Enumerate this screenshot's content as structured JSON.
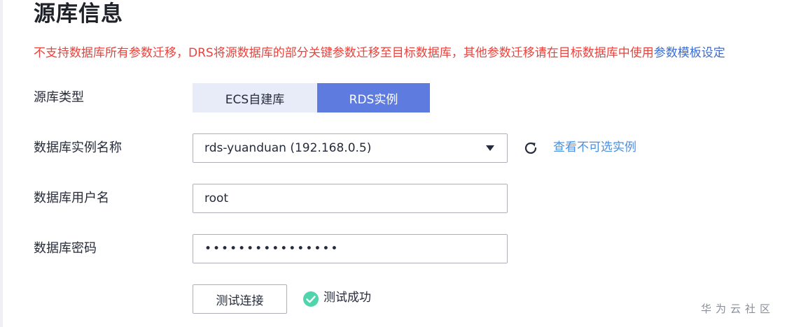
{
  "section": {
    "title": "源库信息",
    "warning_text": "不支持数据库所有参数迁移，DRS将源数据库的部分关键参数迁移至目标数据库，其他参数迁移请在目标数据库中使用",
    "warning_link": "参数模板设定"
  },
  "source_type": {
    "label": "源库类型",
    "options": [
      "ECS自建库",
      "RDS实例"
    ],
    "selected": "RDS实例"
  },
  "instance": {
    "label": "数据库实例名称",
    "value": "rds-yuanduan (192.168.0.5)",
    "view_link": "查看不可选实例",
    "refresh_icon": "refresh-icon"
  },
  "username": {
    "label": "数据库用户名",
    "value": "root"
  },
  "password": {
    "label": "数据库密码",
    "masked_value": "••••••••••••••••"
  },
  "test": {
    "button_label": "测试连接",
    "status_text": "测试成功",
    "status_icon": "check-circle-icon",
    "success_color": "#50d4ab"
  },
  "watermark": "华为云社区",
  "colors": {
    "accent": "#5e7ce0",
    "warning": "#e8433d",
    "link": "#4a8fe0"
  }
}
